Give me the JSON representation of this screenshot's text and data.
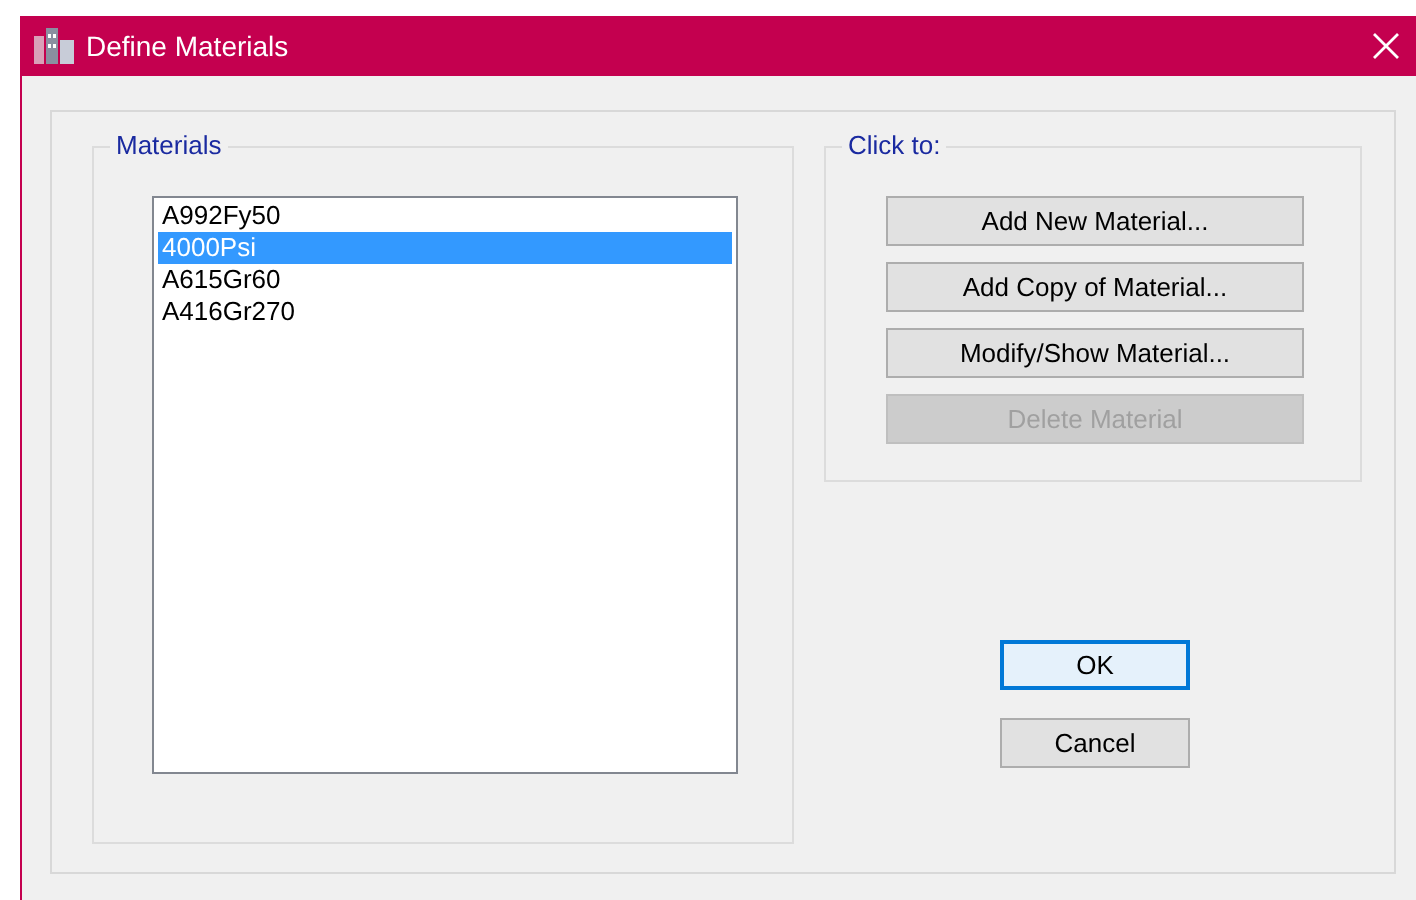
{
  "window": {
    "title": "Define Materials"
  },
  "materials": {
    "label": "Materials",
    "items": [
      {
        "name": "A992Fy50",
        "selected": false
      },
      {
        "name": "4000Psi",
        "selected": true
      },
      {
        "name": "A615Gr60",
        "selected": false
      },
      {
        "name": "A416Gr270",
        "selected": false
      }
    ]
  },
  "actions": {
    "label": "Click to:",
    "buttons": [
      {
        "label": "Add New Material...",
        "disabled": false
      },
      {
        "label": "Add Copy of Material...",
        "disabled": false
      },
      {
        "label": "Modify/Show Material...",
        "disabled": false
      },
      {
        "label": "Delete Material",
        "disabled": true
      }
    ]
  },
  "dialog_buttons": [
    {
      "label": "OK",
      "default": true
    },
    {
      "label": "Cancel",
      "default": false
    }
  ]
}
